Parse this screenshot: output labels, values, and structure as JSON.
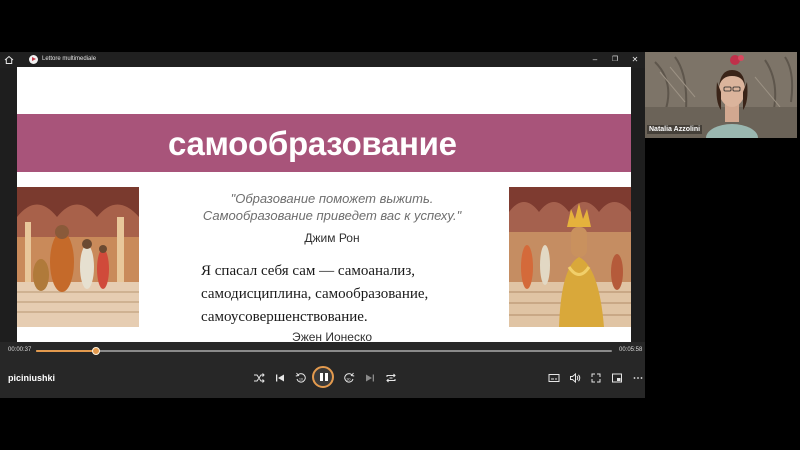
{
  "window": {
    "title": "Lettore multimediale",
    "minimize": "–",
    "restore": "❐",
    "close": "✕"
  },
  "slide": {
    "title": "самообразование",
    "quote1_line1": "\"Образование поможет выжить.",
    "quote1_line2": "Самообразование приведет вас к успеху.\"",
    "quote1_author": "Джим Рон",
    "quote2_line1": "Я спасал себя сам — самоанализ,",
    "quote2_line2": "самодисциплина, самообразование,",
    "quote2_line3": "самоусовершенствование.",
    "quote2_author": "Эжен Ионеско"
  },
  "player": {
    "current_time": "00:00:37",
    "total_time": "00:05:58",
    "progress_fraction": 0.104,
    "media_name": "piciniushki",
    "accent_color": "#e39a4e",
    "icons": [
      "shuffle-icon",
      "previous-icon",
      "rewind-10-icon",
      "pause-icon",
      "forward-30-icon",
      "next-icon",
      "repeat-icon",
      "subtitles-icon",
      "volume-icon",
      "fullscreen-icon",
      "mini-player-icon",
      "more-icon"
    ]
  },
  "participant": {
    "name": "Natalia Azzolini"
  }
}
